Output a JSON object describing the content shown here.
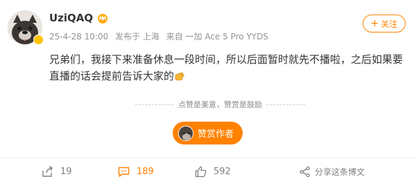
{
  "post": {
    "username": "UziQAQ",
    "date": "25-4-28 10:00",
    "location": "发布于 上海",
    "source": "来自 一加 Ace 5 Pro YYDS",
    "content": "兄弟们，我接下来准备休息一段时间，所以后面暂时就先不播啦，之后如果要直播的话会提前告诉大家的",
    "emoji": "hand-wave-emoji"
  },
  "header": {
    "follow_label": "关注",
    "follow_plus": "+"
  },
  "reward": {
    "tip": "点赞是美意，赞赏是鼓励",
    "button_label": "赞赏作者"
  },
  "actions": {
    "share_count": "19",
    "comment_count": "189",
    "like_count": "592",
    "forward_label": "分享这条博文"
  },
  "colors": {
    "accent": "#ff8200",
    "muted": "#939393",
    "text": "#333333",
    "vip_badge": "#ffc300"
  }
}
